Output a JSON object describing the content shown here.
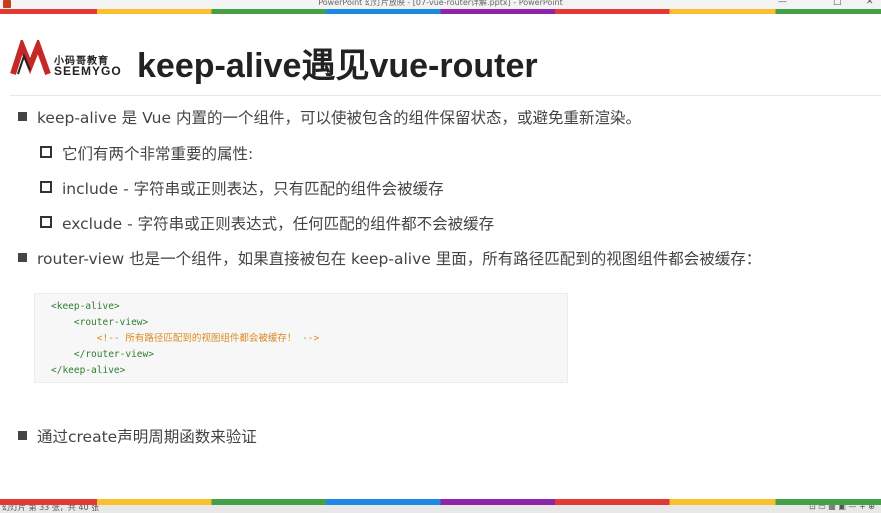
{
  "window": {
    "title": "PowerPoint 幻灯片放映 - [07-vue-router详解.pptx] - PowerPoint",
    "minimize": "—",
    "maximize": "□",
    "close": "✕"
  },
  "logo": {
    "brand_cn": "小码哥教育",
    "brand_en": "SEEMYGO",
    "accent": "#c62828"
  },
  "slide": {
    "title": "keep-alive遇见vue-router",
    "bullets": [
      {
        "text": "keep-alive 是 Vue 内置的一个组件，可以使被包含的组件保留状态，或避免重新渲染。"
      },
      {
        "text": "router-view 也是一个组件，如果直接被包在 keep-alive 里面，所有路径匹配到的视图组件都会被缓存："
      },
      {
        "text": "通过create声明周期函数来验证"
      }
    ],
    "sub_bullets": [
      {
        "text": "它们有两个非常重要的属性:"
      },
      {
        "text": "include - 字符串或正则表达，只有匹配的组件会被缓存"
      },
      {
        "text": "exclude - 字符串或正则表达式，任何匹配的组件都不会被缓存"
      }
    ],
    "code_lines": [
      {
        "text": "<keep-alive>",
        "kind": "tag"
      },
      {
        "text": "    <router-view>",
        "kind": "tag"
      },
      {
        "text": "        <!-- 所有路径匹配到的视图组件都会被缓存！ -->",
        "kind": "comment"
      },
      {
        "text": "    </router-view>",
        "kind": "tag"
      },
      {
        "text": "</keep-alive>",
        "kind": "tag"
      }
    ]
  },
  "colors": {
    "code_tag": "#2e7d32",
    "code_comment": "#d98a1f"
  },
  "statusbar": {
    "left": "幻灯片 第 33 张，共 40 张",
    "right": "⊡  ▭  ▦  ▣  —  +  ⊕"
  }
}
